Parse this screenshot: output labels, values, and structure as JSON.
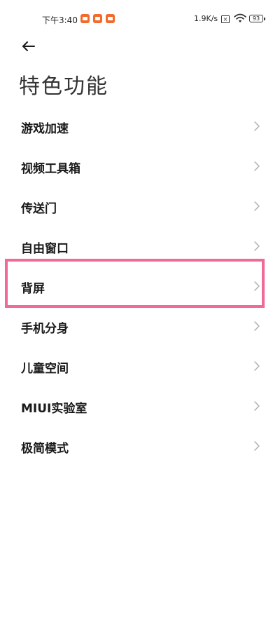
{
  "status_bar": {
    "time": "下午3:40",
    "network_speed": "1.9K/s",
    "sim_label": "×",
    "battery_level": "93",
    "notification_color": "#f26b2d",
    "icons": [
      "notification-app-icon",
      "notification-app-icon",
      "notification-app-icon",
      "sim-card-icon",
      "wifi-icon",
      "battery-icon"
    ]
  },
  "header": {
    "back_icon": "arrow-left-icon",
    "title": "特色功能"
  },
  "menu": {
    "items": [
      {
        "label": "游戏加速"
      },
      {
        "label": "视频工具箱"
      },
      {
        "label": "传送门"
      },
      {
        "label": "自由窗口"
      },
      {
        "label": "背屏"
      },
      {
        "label": "手机分身"
      },
      {
        "label": "儿童空间"
      },
      {
        "label": "MIUI实验室"
      },
      {
        "label": "极简模式"
      }
    ],
    "highlighted_label": "背屏",
    "highlight_color": "#ef6a97",
    "chevron_icon": "chevron-right-icon"
  }
}
